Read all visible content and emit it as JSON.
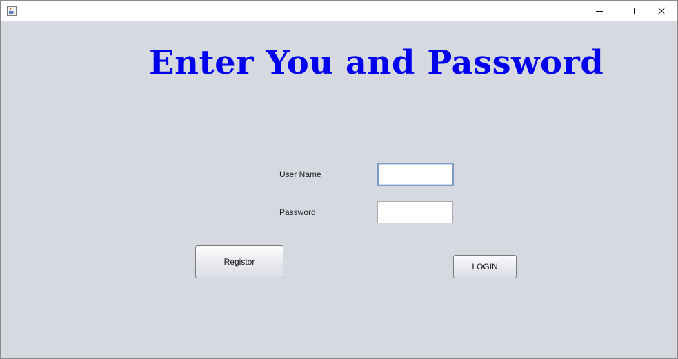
{
  "window": {
    "app_icon": "java-coffee-cup-icon",
    "controls": {
      "minimize_icon": "minimize-icon",
      "maximize_icon": "maximize-icon",
      "close_icon": "close-icon"
    }
  },
  "main": {
    "heading": "Enter You and Password",
    "heading_color": "#0000EE",
    "username_label": "User Name",
    "username_value": "",
    "password_label": "Password",
    "password_value": "",
    "register_button": "Registor",
    "login_button": "LOGIN"
  }
}
